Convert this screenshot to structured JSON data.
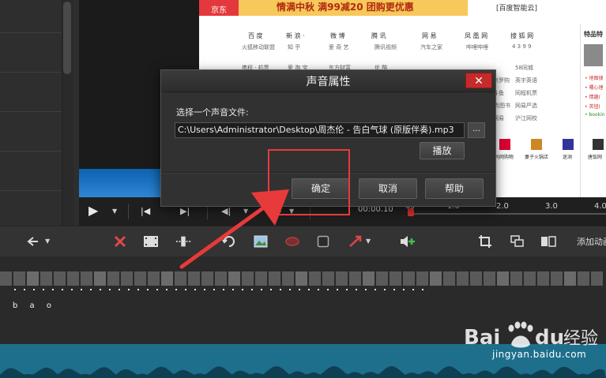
{
  "dialog": {
    "title": "声音属性",
    "close_glyph": "✕",
    "prompt": "选择一个声音文件:",
    "path_value": "C:\\Users\\Administrator\\Desktop\\周杰伦 - 告白气球 (原版伴奏).mp3",
    "browse_label": "...",
    "play_label": "播放",
    "ok_label": "确定",
    "cancel_label": "取消",
    "help_label": "帮助"
  },
  "transport": {
    "time": "00:00.10",
    "ruler_labels": [
      "0s",
      "1.0",
      "2.0",
      "3.0",
      "4.0"
    ]
  },
  "toolbar": {
    "add_animation_label": "添加动画",
    "icons": [
      "undo-icon",
      "delete-icon",
      "film-icon",
      "split-icon",
      "rotate-icon",
      "image-icon",
      "shape-ellipse-icon",
      "shape-rect-icon",
      "arrow-tool-icon",
      "add-audio-icon",
      "crop-icon",
      "layers-icon",
      "mirror-icon"
    ]
  },
  "webpage": {
    "ad_jd": "京东",
    "ad_festival": "情满中秋  满99减20 团购更优惠",
    "ad_tencent": "[百度智能云]",
    "nav_row1": [
      "百 度",
      "新 浪 ·",
      "微 博",
      "腾 讯",
      "网 易",
      "凤 凰 网",
      "搜 狐 网"
    ],
    "nav_row1_sub": [
      "火狐移动联盟",
      "知 乎",
      "爱 奇 艺",
      "腾讯视频",
      "汽车之家",
      "哔哩哔哩",
      "4 3 9 9"
    ],
    "nav_row2": [
      "携程 · 机票",
      "爱 淘 宝",
      "东方财富",
      "优 酷"
    ],
    "right_col": [
      "58同城",
      "英宇英语",
      "同程机票",
      "网易严选",
      "沪江网校"
    ],
    "left_col_mid": [
      "京罗购",
      "斗鱼",
      "起点图书",
      "网易"
    ],
    "right_widget_title": "特品特",
    "right_widget_lines": [
      "• 地图搜",
      "• 曙心理",
      "• 情趣(",
      "• 英钮(",
      "• bookin"
    ],
    "thumb_labels": [
      "妈网购物",
      "妻子火锅店",
      "迷洞",
      "唐饭网"
    ]
  },
  "timeline": {
    "track_text": "b a o"
  },
  "watermark": {
    "brand": "Bai du 经验",
    "url": "jingyan.baidu.com"
  },
  "colors": {
    "accent_red": "#e83a3a",
    "dialog_bg": "#313131",
    "audio_track": "#1e6f8c"
  }
}
